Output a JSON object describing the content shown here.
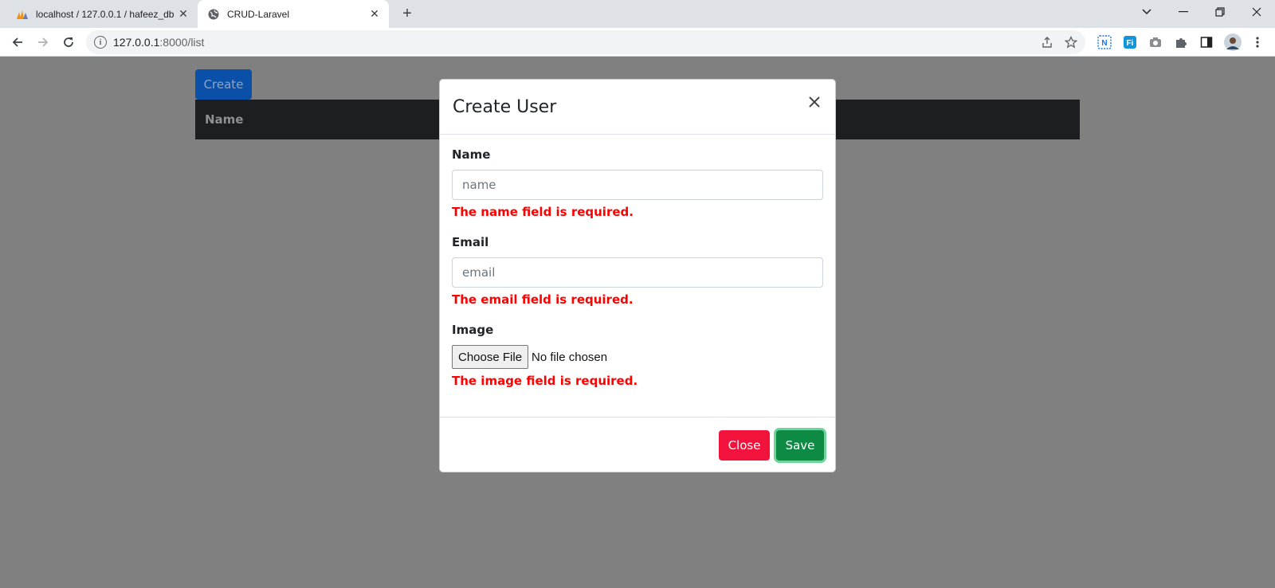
{
  "browser": {
    "tabs": [
      {
        "title": "localhost / 127.0.0.1 / hafeez_db |",
        "favicon": "phpmyadmin-icon"
      },
      {
        "title": "CRUD-Laravel",
        "favicon": "globe-icon"
      }
    ],
    "url_host": "127.0.0.1",
    "url_path": ":8000/list"
  },
  "page": {
    "create_label": "Create",
    "table_columns": [
      "Name"
    ]
  },
  "modal": {
    "title": "Create User",
    "fields": {
      "name": {
        "label": "Name",
        "placeholder": "name",
        "error": "The name field is required."
      },
      "email": {
        "label": "Email",
        "placeholder": "email",
        "error": "The email field is required."
      },
      "image": {
        "label": "Image",
        "button": "Choose File",
        "status": "No file chosen",
        "error": "The image field is required."
      }
    },
    "close_label": "Close",
    "save_label": "Save"
  },
  "colors": {
    "error": "#ff0000",
    "close_button": "#f2133c",
    "save_button": "#0d8a44",
    "create_button": "#0a4fa8"
  }
}
